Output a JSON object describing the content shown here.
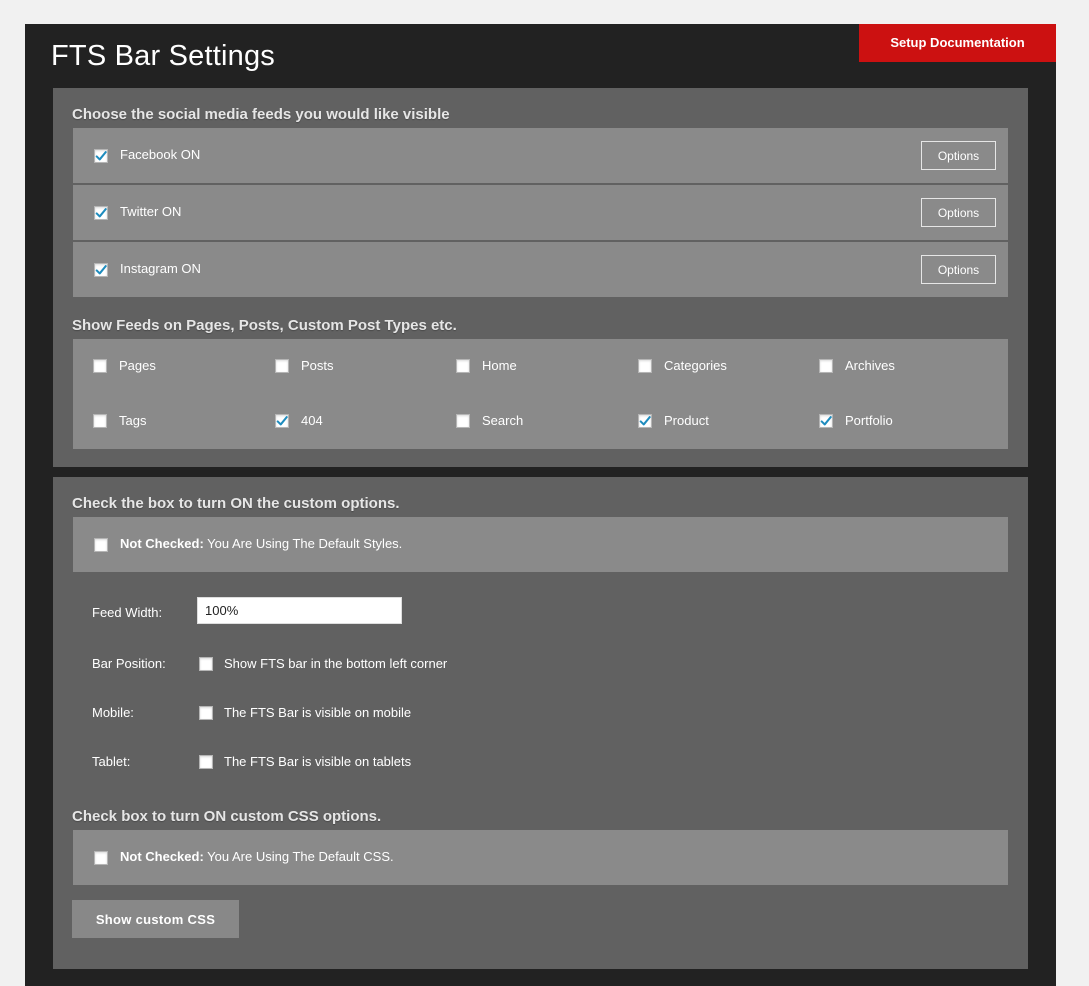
{
  "header": {
    "title": "FTS Bar Settings",
    "doc_button": "Setup Documentation"
  },
  "feeds": {
    "heading": "Choose the social media feeds you would like visible",
    "items": [
      {
        "label": "Facebook ON",
        "checked": true,
        "button": "Options"
      },
      {
        "label": "Twitter ON",
        "checked": true,
        "button": "Options"
      },
      {
        "label": "Instagram ON",
        "checked": true,
        "button": "Options"
      }
    ]
  },
  "show_on": {
    "heading": "Show Feeds on Pages, Posts, Custom Post Types etc.",
    "items": [
      {
        "label": "Pages",
        "checked": false
      },
      {
        "label": "Posts",
        "checked": false
      },
      {
        "label": "Home",
        "checked": false
      },
      {
        "label": "Categories",
        "checked": false
      },
      {
        "label": "Archives",
        "checked": false
      },
      {
        "label": "Tags",
        "checked": false
      },
      {
        "label": "404",
        "checked": true
      },
      {
        "label": "Search",
        "checked": false
      },
      {
        "label": "Product",
        "checked": true
      },
      {
        "label": "Portfolio",
        "checked": true
      }
    ]
  },
  "custom_options": {
    "heading": "Check the box to turn ON the custom options.",
    "notice_bold": "Not Checked:",
    "notice_text": " You Are Using The Default Styles.",
    "checked": false
  },
  "settings": {
    "feed_width_label": "Feed Width:",
    "feed_width_value": "100%",
    "bar_position_label": "Bar Position:",
    "bar_position_text": "Show FTS bar in the bottom left corner",
    "mobile_label": "Mobile:",
    "mobile_text": "The FTS Bar is visible on mobile",
    "tablet_label": "Tablet:",
    "tablet_text": "The FTS Bar is visible on tablets"
  },
  "custom_css": {
    "heading": "Check box to turn ON custom CSS options.",
    "notice_bold": "Not Checked:",
    "notice_text": " You Are Using The Default CSS.",
    "checked": false,
    "button": "Show custom CSS"
  },
  "colors": {
    "accent_red": "#cc1111",
    "check_blue": "#1e8cbe"
  }
}
